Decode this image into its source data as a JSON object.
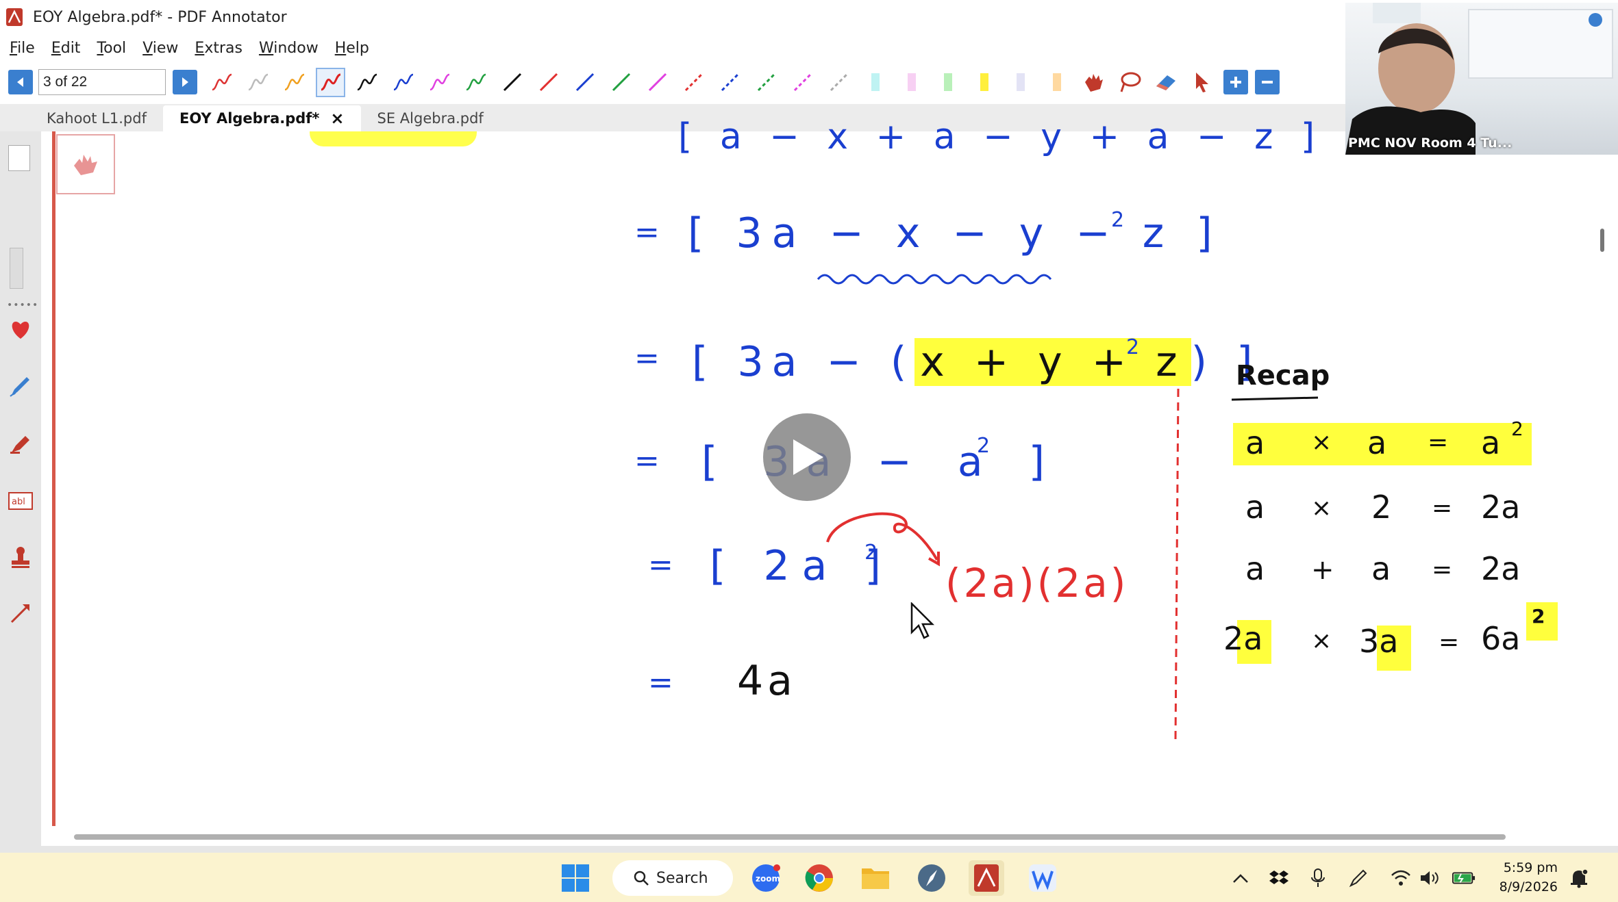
{
  "window": {
    "title": "EOY Algebra.pdf* - PDF Annotator"
  },
  "menu": [
    "File",
    "Edit",
    "Tool",
    "View",
    "Extras",
    "Window",
    "Help"
  ],
  "toolbar": {
    "page_indicator": "3 of 22"
  },
  "tabs": [
    {
      "label": "Kahoot L1.pdf",
      "active": false
    },
    {
      "label": "EOY Algebra.pdf*",
      "active": true,
      "close": "×"
    },
    {
      "label": "SE Algebra.pdf",
      "active": false
    }
  ],
  "video": {
    "label": "PMC NOV Room 4 Tu..."
  },
  "handwriting": {
    "line1": "[ a − x + a − y + a − z ]",
    "line2_eq": "=",
    "line2": "[ 3a − x − y − z ]",
    "line2_exp": "2",
    "line3_eq": "=",
    "line3_pre": "[ 3a − (",
    "line3_hl": "x + y + z",
    "line3_post": ") ]",
    "line3_exp": "2",
    "line4_eq": "=",
    "line4": "[ 3a − a ]",
    "line4_exp": "2",
    "line5_eq": "=",
    "line5": "[ 2a ]",
    "line5_exp": "2",
    "line5_red": "(2a)(2a)",
    "line6_eq": "=",
    "line6": "4a"
  },
  "recap": {
    "title": "Recap",
    "rows": [
      {
        "a": "a",
        "op": "×",
        "b": "a",
        "eq": "=",
        "r": "a",
        "exp": "2"
      },
      {
        "a": "a",
        "op": "×",
        "b": "2",
        "eq": "=",
        "r": "2a",
        "exp": ""
      },
      {
        "a": "a",
        "op": "+",
        "b": "a",
        "eq": "=",
        "r": "2a",
        "exp": ""
      },
      {
        "a": "2a",
        "op": "×",
        "b": "3a",
        "eq": "=",
        "r": "6a",
        "exp": "2"
      }
    ]
  },
  "taskbar": {
    "search_label": "Search",
    "time": "5:59 pm",
    "date": "8/9/2026"
  },
  "colors": {
    "ink_blue": "#1a3fd0",
    "ink_red": "#e23030",
    "highlight": "#ffff3d",
    "accent": "#3a7fcf"
  }
}
